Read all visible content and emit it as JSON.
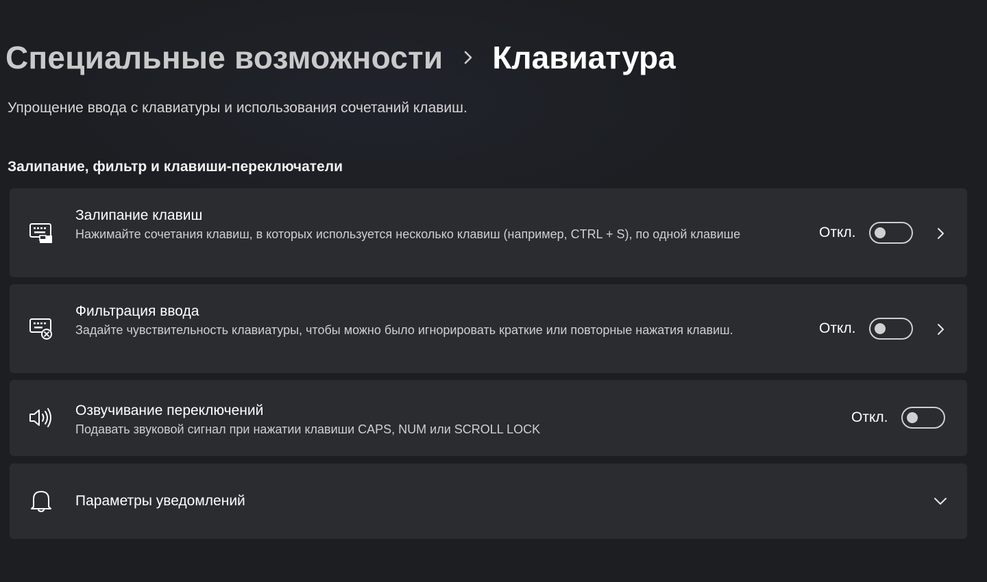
{
  "breadcrumb": {
    "parent": "Специальные возможности",
    "current": "Клавиатура"
  },
  "page": {
    "subtitle": "Упрощение ввода с клавиатуры и использования сочетаний клавиш."
  },
  "section": {
    "title": "Залипание, фильтр и клавиши-переключатели"
  },
  "settings": [
    {
      "title": "Залипание клавиш",
      "description": "Нажимайте сочетания клавиш, в которых используется несколько клавиш (например, CTRL + S), по одной клавише",
      "state": "Откл.",
      "icon": "sticky-keys-icon"
    },
    {
      "title": "Фильтрация ввода",
      "description": "Задайте чувствительность клавиатуры, чтобы можно было игнорировать краткие или повторные нажатия клавиш.",
      "state": "Откл.",
      "icon": "filter-keys-icon"
    },
    {
      "title": "Озвучивание переключений",
      "description": "Подавать звуковой сигнал при нажатии клавиши CAPS, NUM или SCROLL LOCK",
      "state": "Откл.",
      "icon": "speaker-icon"
    },
    {
      "title": "Параметры уведомлений",
      "icon": "bell-icon"
    }
  ],
  "colors": {
    "background": "#1c1e22",
    "card": "#2a2c30",
    "text": "#ffffff",
    "secondary_text": "#cfcfcf"
  }
}
